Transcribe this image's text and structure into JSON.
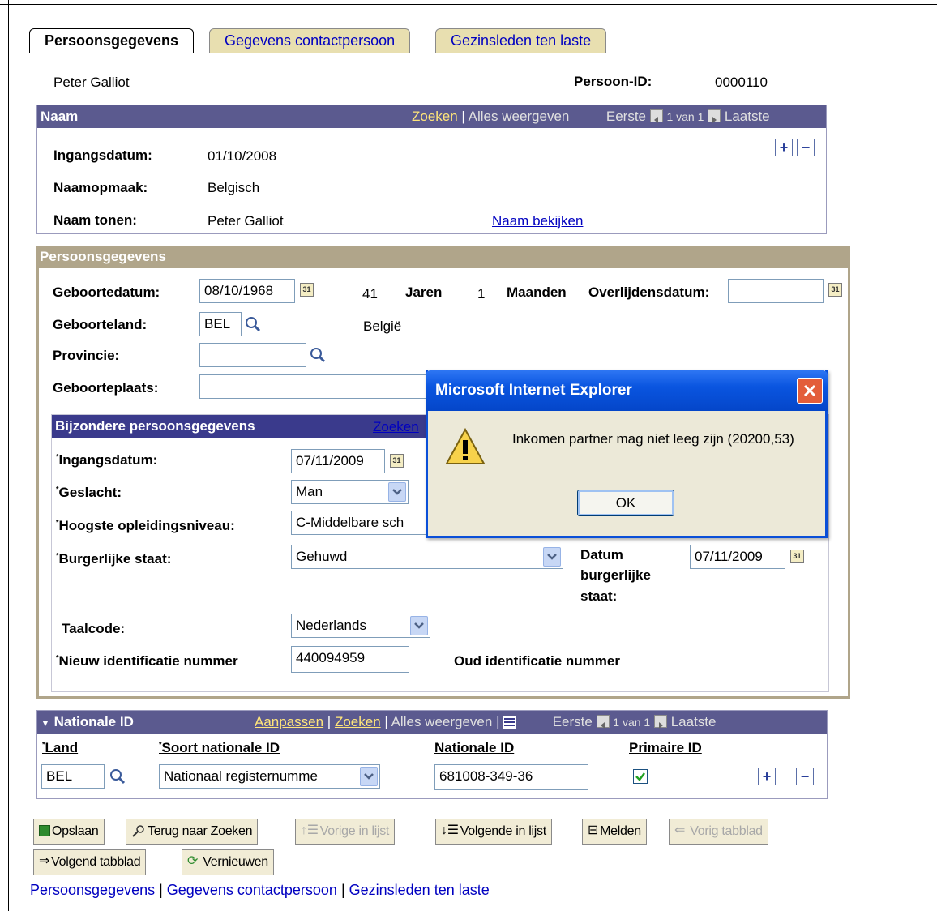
{
  "tabs": [
    {
      "label": "Persoonsgegevens",
      "active": true
    },
    {
      "label": "Gegevens contactpersoon",
      "active": false
    },
    {
      "label": "Gezinsleden ten laste",
      "active": false
    }
  ],
  "person": {
    "name": "Peter Galliot",
    "id_label": "Persoon-ID:",
    "id_value": "0000110"
  },
  "naam": {
    "title": "Naam",
    "nav": {
      "zoeken": "Zoeken",
      "alles": "Alles weergeven",
      "eerste": "Eerste",
      "count": "1 van 1",
      "laatste": "Laatste"
    },
    "ingang_label": "Ingangsdatum:",
    "ingang_value": "01/10/2008",
    "opmaak_label": "Naamopmaak:",
    "opmaak_value": "Belgisch",
    "tonen_label": "Naam tonen:",
    "tonen_value": "Peter Galliot",
    "bekijken": "Naam bekijken"
  },
  "persoonsgegevens": {
    "title": "Persoonsgegevens",
    "geboortedatum_label": "Geboortedatum:",
    "geboortedatum_value": "08/10/1968",
    "jaren_value": "41",
    "jaren_label": "Jaren",
    "maanden_value": "1",
    "maanden_label": "Maanden",
    "overlijden_label": "Overlijdensdatum:",
    "overlijden_value": "",
    "geboorteland_label": "Geboorteland:",
    "geboorteland_value": "BEL",
    "land_name": "België",
    "provincie_label": "Provincie:",
    "provincie_value": "",
    "geboorteplaats_label": "Geboorteplaats:",
    "geboorteplaats_value": ""
  },
  "bijzondere": {
    "title": "Bijzondere persoonsgegevens",
    "zoeken": "Zoeken",
    "ingang_label": "Ingangsdatum:",
    "ingang_value": "07/11/2009",
    "geslacht_label": "Geslacht:",
    "geslacht_value": "Man",
    "opleiding_label": "Hoogste opleidingsniveau:",
    "opleiding_value": "C-Middelbare sch",
    "staat_label": "Burgerlijke staat:",
    "staat_value": "Gehuwd",
    "datum_staat_label_1": "Datum",
    "datum_staat_label_2": "burgerlijke",
    "datum_staat_label_3": "staat:",
    "datum_staat_value": "07/11/2009",
    "taal_label": "Taalcode:",
    "taal_value": "Nederlands",
    "nieuw_id_label": "Nieuw identificatie nummer",
    "nieuw_id_value": "440094959",
    "oud_id_label": "Oud identificatie nummer"
  },
  "nationale": {
    "title": "Nationale ID",
    "nav": {
      "aanpassen": "Aanpassen",
      "zoeken": "Zoeken",
      "alles": "Alles weergeven",
      "eerste": "Eerste",
      "count": "1 van 1",
      "laatste": "Laatste"
    },
    "col_land": "Land",
    "col_soort": "Soort nationale ID",
    "col_id": "Nationale ID",
    "col_primair": "Primaire ID",
    "land_value": "BEL",
    "soort_value": "Nationaal registernumme",
    "id_value": "681008-349-36",
    "primair_checked": true
  },
  "toolbar": {
    "opslaan": "Opslaan",
    "terug": "Terug naar Zoeken",
    "vorige": "Vorige in lijst",
    "volgende": "Volgende in lijst",
    "melden": "Melden",
    "vorig_tab": "Vorig tabblad",
    "volgend_tab": "Volgend tabblad",
    "vernieuwen": "Vernieuwen"
  },
  "footer": {
    "l1": "Persoonsgegevens",
    "l2": "Gegevens contactpersoon",
    "l3": "Gezinsleden ten laste"
  },
  "dialog": {
    "title": "Microsoft Internet Explorer",
    "message": "Inkomen partner mag niet leeg zijn (20200,53)",
    "ok": "OK"
  }
}
